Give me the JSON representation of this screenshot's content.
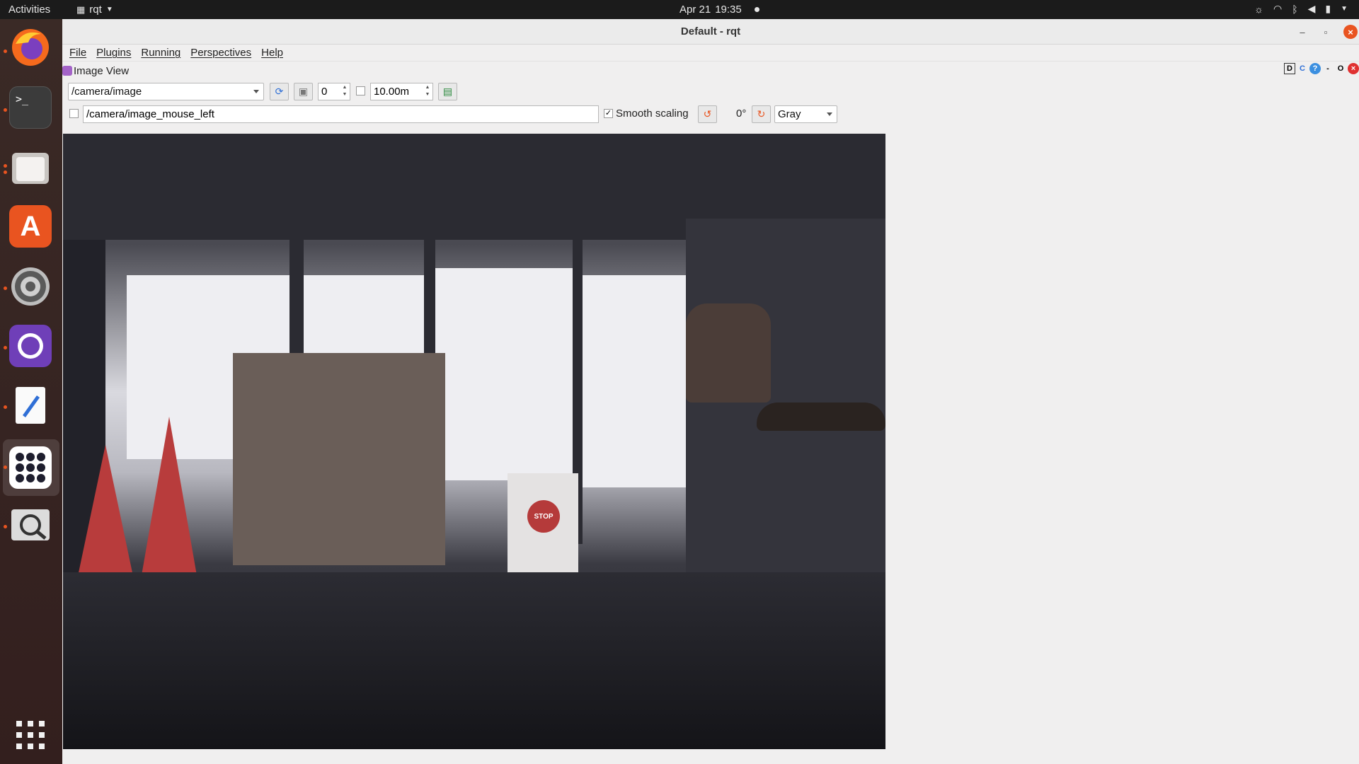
{
  "topbar": {
    "activities": "Activities",
    "app_name": "rqt",
    "date": "Apr 21",
    "time": "19:35"
  },
  "window": {
    "title": "Default - rqt"
  },
  "menu": [
    "File",
    "Plugins",
    "Running",
    "Perspectives",
    "Help"
  ],
  "plugin": {
    "title": "Image View",
    "controls": [
      "D",
      "C",
      "?",
      "-",
      "O",
      "×"
    ]
  },
  "toolbar": {
    "topic": "/camera/image",
    "spin_value": "0",
    "duration": "10.00m",
    "mouse_topic": "/camera/image_mouse_left",
    "smooth_scaling_label": "Smooth scaling",
    "smooth_scaling_checked": true,
    "rotation": "0°",
    "color_scheme": "Gray"
  },
  "image": {
    "stop_sign_text": "STOP"
  },
  "dock": {
    "apps": [
      "firefox",
      "terminal",
      "files",
      "app-center",
      "settings",
      "github-desktop",
      "text-editor",
      "show-apps-active",
      "image-viewer"
    ],
    "show_apps": "show-apps"
  }
}
